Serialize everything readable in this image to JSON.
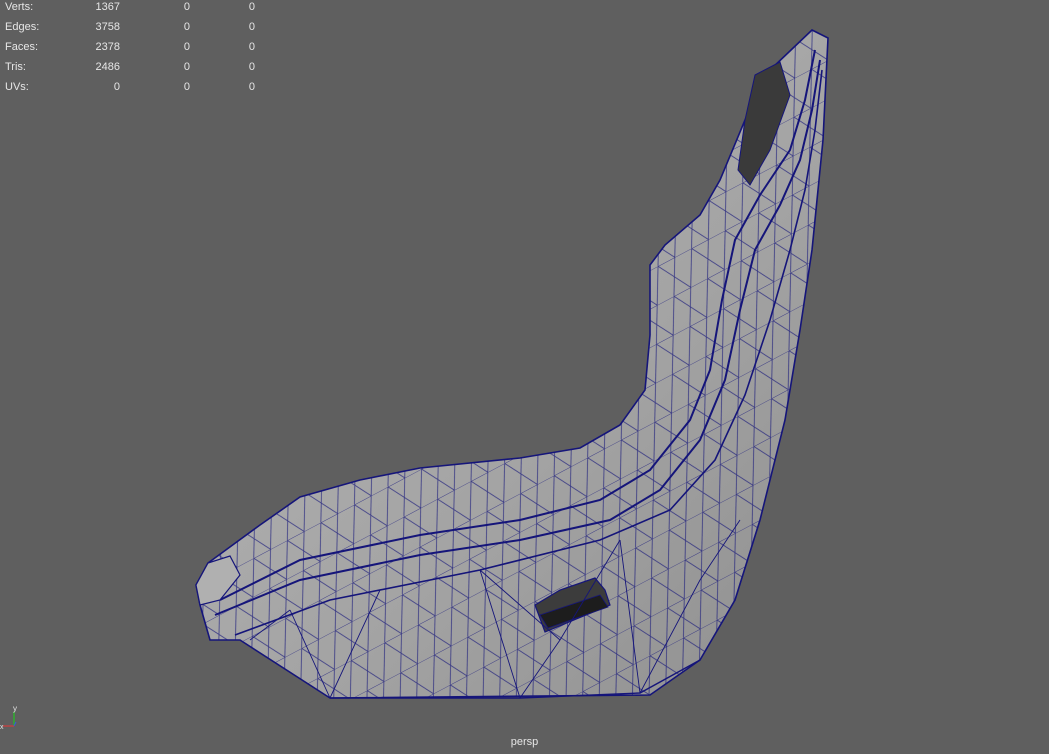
{
  "viewport": {
    "camera": "persp",
    "background_color": "#5f5f5f",
    "wireframe_color": "#15157a",
    "shaded_color": "#a6a6a6"
  },
  "hud": {
    "rows": [
      {
        "label": "Verts:",
        "v1": "1367",
        "v2": "0",
        "v3": "0"
      },
      {
        "label": "Edges:",
        "v1": "3758",
        "v2": "0",
        "v3": "0"
      },
      {
        "label": "Faces:",
        "v1": "2378",
        "v2": "0",
        "v3": "0"
      },
      {
        "label": "Tris:",
        "v1": "2486",
        "v2": "0",
        "v3": "0"
      },
      {
        "label": "UVs:",
        "v1": "0",
        "v2": "0",
        "v3": "0"
      }
    ]
  },
  "axis_gizmo": {
    "y_label": "y",
    "x_label": "x"
  },
  "model": {
    "name_icon": "seat-mesh"
  }
}
